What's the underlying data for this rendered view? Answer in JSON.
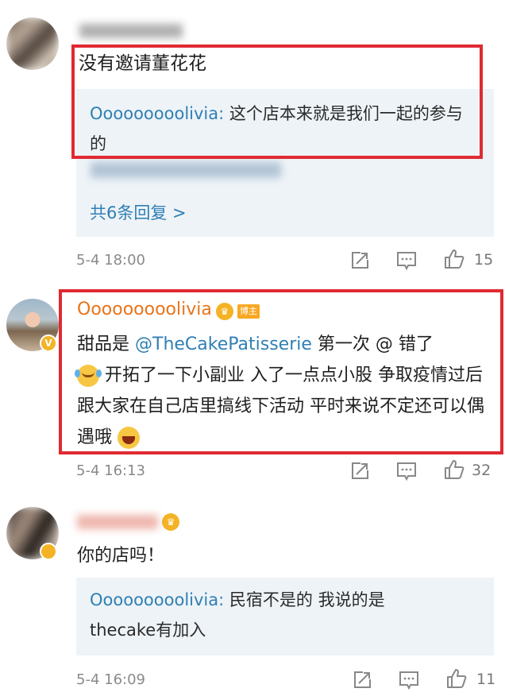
{
  "comments": [
    {
      "text": "没有邀请董花花",
      "reply": {
        "author": "Ooooooooolivia",
        "sep": ": ",
        "text": "这个店本来就是我们一起的参与的"
      },
      "more_replies": "共6条回复 >",
      "time": "5-4 18:00",
      "likes": "15"
    },
    {
      "author": "Ooooooooolivia",
      "badge": "博主",
      "text_prefix": "甜品是 ",
      "mention": "@TheCakePatisserie",
      "text_line1_rest": "  第一次 @ 错了",
      "text_rest": " 开拓了一下小副业 入了一点点小股  争取疫情过后跟大家在自己店里搞线下活动 平时来说不定还可以偶遇哦 ",
      "time": "5-4 16:13",
      "likes": "32"
    },
    {
      "text": "你的店吗！",
      "reply": {
        "author": "Ooooooooolivia",
        "sep": ": ",
        "text": "民宿不是的  我说的是thecake有加入"
      },
      "time": "5-4 16:09",
      "likes": "11"
    }
  ],
  "colors": {
    "link": "#2f7fb4",
    "author_highlight": "#e8741a",
    "frame_red": "#e02a32",
    "reply_bg": "#eef3f7",
    "meta_grey": "#8a8a8a"
  },
  "icons": [
    "repost-icon",
    "comment-icon",
    "like-icon",
    "laughing-crying-emoji",
    "laughing-emoji",
    "fan-crown-icon"
  ]
}
